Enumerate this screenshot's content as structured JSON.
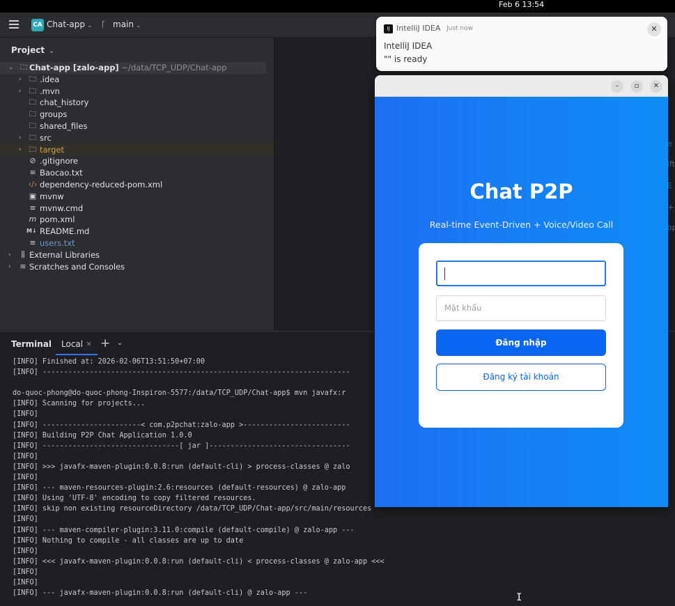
{
  "system": {
    "clock": "Feb 6  13:54"
  },
  "ide": {
    "project_badge": "CA",
    "project_name": "Chat-app",
    "branch": "main",
    "project_panel_title": "Project",
    "tree": [
      {
        "label": "Chat-app [zalo-app]",
        "extra": " ~/data/TCP_UDP/Chat-app",
        "icon": "folder-icon"
      },
      {
        "label": ".idea",
        "icon": "folder-icon"
      },
      {
        "label": ".mvn",
        "icon": "folder-icon"
      },
      {
        "label": "chat_history",
        "icon": "folder-icon"
      },
      {
        "label": "groups",
        "icon": "folder-icon"
      },
      {
        "label": "shared_files",
        "icon": "folder-icon"
      },
      {
        "label": "src",
        "icon": "folder-icon"
      },
      {
        "label": "target",
        "icon": "folder-icon"
      },
      {
        "label": ".gitignore",
        "icon": "ignore-file-icon"
      },
      {
        "label": "Baocao.txt",
        "icon": "text-file-icon"
      },
      {
        "label": "dependency-reduced-pom.xml",
        "icon": "xml-file-icon"
      },
      {
        "label": "mvnw",
        "icon": "script-file-icon"
      },
      {
        "label": "mvnw.cmd",
        "icon": "text-file-icon"
      },
      {
        "label": "pom.xml",
        "icon": "maven-file-icon"
      },
      {
        "label": "README.md",
        "icon": "markdown-file-icon"
      },
      {
        "label": "users.txt",
        "icon": "text-file-icon"
      },
      {
        "label": "External Libraries",
        "icon": "library-icon"
      },
      {
        "label": "Scratches and Consoles",
        "icon": "scratches-icon"
      }
    ],
    "terminal": {
      "title": "Terminal",
      "tab": "Local",
      "lines": [
        "[INFO] Finished at: 2026-02-06T13:51:50+07:00",
        "[INFO] ------------------------------------------------------------------------",
        "",
        "do-quoc-phong@do-quoc-phong-Inspiron-5577:/data/TCP_UDP/Chat-app$ mvn javafx:r",
        "[INFO] Scanning for projects...",
        "[INFO]",
        "[INFO] -----------------------< com.p2pchat:zalo-app >-------------------------",
        "[INFO] Building P2P Chat Application 1.0.0",
        "[INFO] --------------------------------[ jar ]---------------------------------",
        "[INFO]",
        "[INFO] >>> javafx-maven-plugin:0.0.8:run (default-cli) > process-classes @ zalo",
        "[INFO]",
        "[INFO] --- maven-resources-plugin:2.6:resources (default-resources) @ zalo-app",
        "[INFO] Using 'UTF-8' encoding to copy filtered resources.",
        "[INFO] skip non existing resourceDirectory /data/TCP_UDP/Chat-app/src/main/resources",
        "[INFO]",
        "[INFO] --- maven-compiler-plugin:3.11.0:compile (default-compile) @ zalo-app ---",
        "[INFO] Nothing to compile - all classes are up to date",
        "[INFO]",
        "[INFO] <<< javafx-maven-plugin:0.0.8:run (default-cli) < process-classes @ zalo-app <<<",
        "[INFO]",
        "[INFO]",
        "[INFO] --- javafx-maven-plugin:0.0.8:run (default-cli) @ zalo-app ---"
      ]
    },
    "edge_fragments": [
      "e",
      "ift",
      "E",
      "+",
      "op"
    ]
  },
  "notification": {
    "app": "IntelliJ IDEA",
    "time": "Just now",
    "title": "IntelliJ IDEA",
    "body": "\"\" is ready"
  },
  "app_window": {
    "title": "Chat P2P",
    "subtitle": "Real-time Event-Driven + Voice/Video Call",
    "username_value": "",
    "password_placeholder": "Mật khẩu",
    "login_label": "Đăng nhập",
    "register_label": "Đăng ký tài khoản",
    "colors": {
      "accent": "#0a66f0",
      "background": "#1481f5"
    }
  }
}
